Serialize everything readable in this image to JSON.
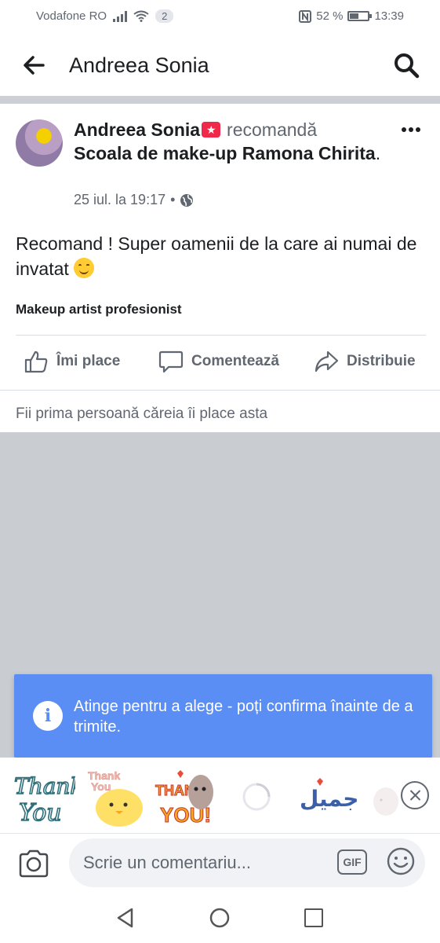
{
  "status_bar": {
    "carrier": "Vodafone RO",
    "notification_count": "2",
    "battery_text": "52 %",
    "battery_level": 0.52,
    "time": "13:39"
  },
  "app_bar": {
    "title": "Andreea Sonia"
  },
  "post": {
    "author": "Andreea Sonia",
    "verb": "recomandă",
    "page_name": "Scoala de make-up Ramona Chirita",
    "page_suffix": ".",
    "timestamp": "25 iul. la 19:17",
    "timestamp_separator": "•",
    "text": "Recomand ! Super oamenii de la care ai numai de invatat",
    "profile_label": "Makeup artist profesionist",
    "actions": {
      "like": "Îmi place",
      "comment": "Comentează",
      "share": "Distribuie"
    },
    "likes_summary": "Fii prima persoană căreia îi place asta"
  },
  "tooltip": {
    "text": "Atinge pentru a alege - poți confirma înainte de a trimite."
  },
  "stickers": [
    {
      "icon": "thank-you-script-sticker",
      "text": "Thank You"
    },
    {
      "icon": "thank-you-chick-sticker",
      "text": "Thank You"
    },
    {
      "icon": "thank-you-bunny-sticker",
      "text": "THANK YOU!"
    },
    {
      "icon": "loading-sticker"
    },
    {
      "icon": "arabic-sticker",
      "text": "جميل"
    },
    {
      "icon": "faded-sticker"
    }
  ],
  "comment_bar": {
    "placeholder": "Scrie un comentariu...",
    "gif_label": "GIF"
  },
  "colors": {
    "accent_blue": "#5b8ef4",
    "badge_red": "#f02849",
    "secondary_text": "#606770",
    "grey_area": "#c9ccd1"
  }
}
